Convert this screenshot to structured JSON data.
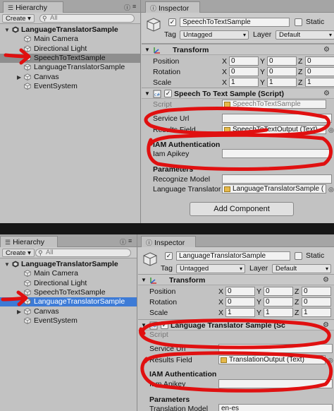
{
  "top": {
    "hierarchy": {
      "tab_label": "Hierarchy",
      "create_label": "Create",
      "create_caret": "▾",
      "search_placeholder": "All",
      "root": "LanguageTranslatorSample",
      "items": [
        "Main Camera",
        "Directional Light",
        "SpeechToTextSample",
        "LanguageTranslatorSample",
        "Canvas",
        "EventSystem"
      ],
      "selected": "SpeechToTextSample"
    },
    "inspector": {
      "tab_label": "Inspector",
      "object_name": "SpeechToTextSample",
      "static_label": "Static",
      "tag_label": "Tag",
      "tag_value": "Untagged",
      "layer_label": "Layer",
      "layer_value": "Default",
      "transform": {
        "title": "Transform",
        "rows": [
          {
            "label": "Position",
            "x": "0",
            "y": "0",
            "z": "0"
          },
          {
            "label": "Rotation",
            "x": "0",
            "y": "0",
            "z": "0"
          },
          {
            "label": "Scale",
            "x": "1",
            "y": "1",
            "z": "1"
          }
        ]
      },
      "script_component": {
        "title": "Speech To Text Sample (Script)",
        "script_label": "Script",
        "script_value": "SpeechToTextSample",
        "service_url_label": "Service Url",
        "service_url_value": "",
        "results_field_label": "Results Field",
        "results_field_value": "SpeechToTextOutput (Text)",
        "iam_header": "IAM Authentication",
        "iam_apikey_label": "Iam Apikey",
        "iam_apikey_value": "",
        "params_header": "Parameters",
        "recognize_model_label": "Recognize Model",
        "recognize_model_value": "",
        "lang_translator_label": "Language Translator",
        "lang_translator_value": "LanguageTranslatorSample ("
      },
      "add_component_label": "Add Component"
    }
  },
  "bottom": {
    "hierarchy": {
      "tab_label": "Hierarchy",
      "create_label": "Create",
      "create_caret": "▾",
      "search_placeholder": "All",
      "root": "LanguageTranslatorSample",
      "items": [
        "Main Camera",
        "Directional Light",
        "SpeechToTextSample",
        "LanguageTranslatorSample",
        "Canvas",
        "EventSystem"
      ],
      "selected": "LanguageTranslatorSample"
    },
    "inspector": {
      "tab_label": "Inspector",
      "object_name": "LanguageTranslatorSample",
      "static_label": "Static",
      "tag_label": "Tag",
      "tag_value": "Untagged",
      "layer_label": "Layer",
      "layer_value": "Default",
      "transform": {
        "title": "Transform",
        "rows": [
          {
            "label": "Position",
            "x": "0",
            "y": "0",
            "z": "0"
          },
          {
            "label": "Rotation",
            "x": "0",
            "y": "0",
            "z": "0"
          },
          {
            "label": "Scale",
            "x": "1",
            "y": "1",
            "z": "1"
          }
        ]
      },
      "script_component": {
        "title": "Language Translator Sample (Sc",
        "script_label": "Script",
        "service_url_label": "Service Url",
        "service_url_value": "",
        "results_field_label": "Results Field",
        "results_field_value": "TranslationOutput (Text)",
        "iam_header": "IAM Authentication",
        "iam_apikey_label": "Iam Apikey",
        "iam_apikey_value": "",
        "params_header": "Parameters",
        "translation_model_label": "Translation Model",
        "translation_model_value": "en-es"
      }
    }
  },
  "colors": {
    "panel_bg": "#c2c2c2",
    "selection_gray": "#8e8e8e",
    "selection_blue": "#3d7bd6",
    "annotation_red": "#e01010",
    "separator": "#161616"
  },
  "icons": {
    "menu": "list-menu-icon",
    "info": "info-icon",
    "scene_unity": "unity-scene-icon",
    "gameobject": "cube-icon",
    "transform": "transform-axes-icon",
    "script": "script-icon",
    "gear": "gear-icon",
    "object_picker": "target-icon"
  },
  "glyphs": {
    "menu": "☰",
    "info": "ⓘ",
    "more": "≡",
    "arrow_down": "▼",
    "arrow_right": "▶",
    "check": "✓",
    "caret": "▾",
    "gear": "⚙",
    "search": "⚲",
    "picker": "◎"
  }
}
